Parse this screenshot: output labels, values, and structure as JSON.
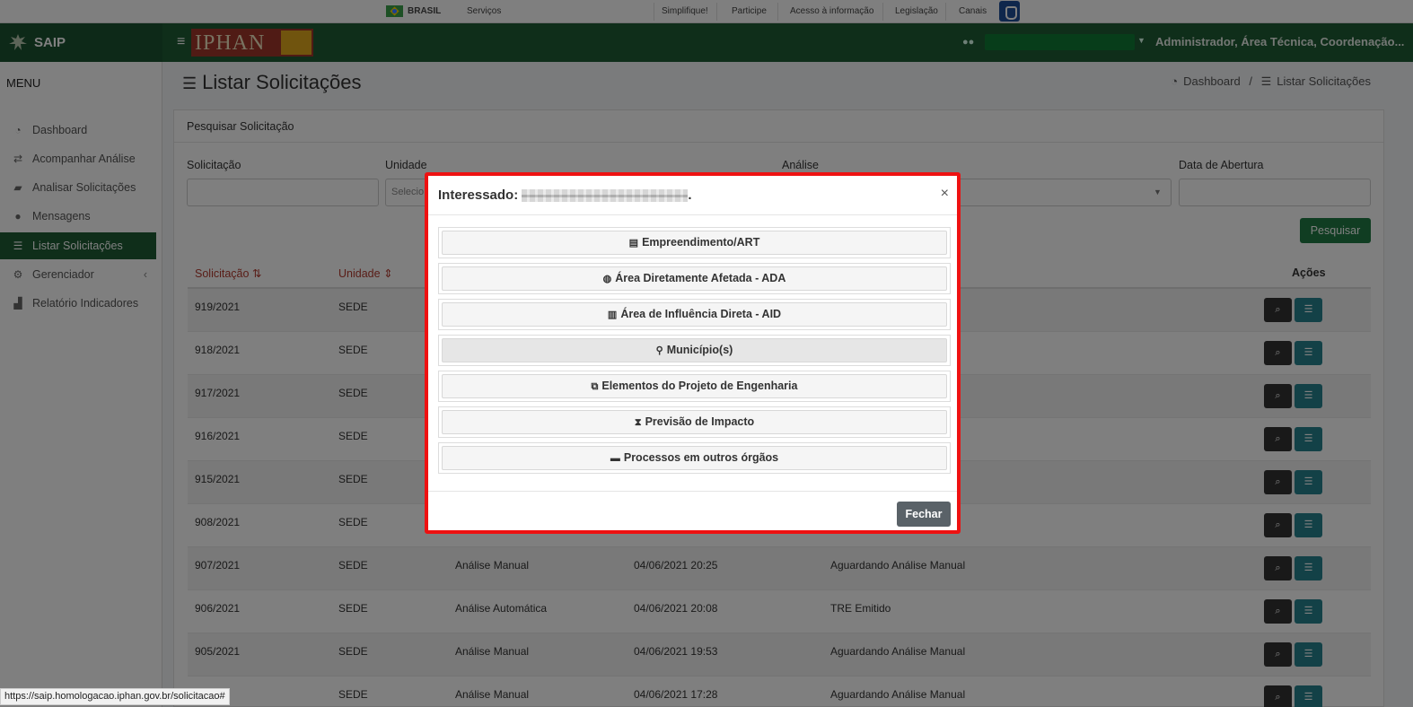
{
  "govbar": {
    "country": "BRASIL",
    "links": [
      "Serviços",
      "Simplifique!",
      "Participe",
      "Acesso à informação",
      "Legislação",
      "Canais"
    ]
  },
  "header": {
    "app_name": "SAIP",
    "logo_text": "IPHAN",
    "roles": "Administrador, Área Técnica, Coordenação..."
  },
  "sidebar": {
    "title": "MENU",
    "items": [
      {
        "label": "Dashboard",
        "icon": "dashboard-icon"
      },
      {
        "label": "Acompanhar Análise",
        "icon": "exchange-icon"
      },
      {
        "label": "Analisar Solicitações",
        "icon": "book-icon"
      },
      {
        "label": "Mensagens",
        "icon": "comments-icon"
      },
      {
        "label": "Listar Solicitações",
        "icon": "list-icon"
      },
      {
        "label": "Gerenciador",
        "icon": "cogs-icon"
      },
      {
        "label": "Relatório Indicadores",
        "icon": "chart-icon"
      }
    ]
  },
  "page": {
    "title": "Listar Solicitações",
    "breadcrumb": [
      "Dashboard",
      "/",
      "Listar Solicitações"
    ]
  },
  "search": {
    "card_title": "Pesquisar Solicitação",
    "labels": {
      "solicitacao": "Solicitação",
      "unidade": "Unidade",
      "analise": "Análise",
      "data": "Data de Abertura"
    },
    "unidade_placeholder": "Selecio",
    "button": "Pesquisar"
  },
  "table": {
    "headers": {
      "solicitacao": "Solicitação",
      "unidade": "Unidade",
      "acoes": "Ações"
    },
    "rows": [
      {
        "id": "919/2021",
        "unidade": "SEDE",
        "analise": "",
        "data": "",
        "status": ""
      },
      {
        "id": "918/2021",
        "unidade": "SEDE",
        "analise": "",
        "data": "",
        "status": ""
      },
      {
        "id": "917/2021",
        "unidade": "SEDE",
        "analise": "",
        "data": "",
        "status": ""
      },
      {
        "id": "916/2021",
        "unidade": "SEDE",
        "analise": "",
        "data": "",
        "status": ""
      },
      {
        "id": "915/2021",
        "unidade": "SEDE",
        "analise": "",
        "data": "",
        "status": ""
      },
      {
        "id": "908/2021",
        "unidade": "SEDE",
        "analise": "",
        "data": "",
        "status": ""
      },
      {
        "id": "907/2021",
        "unidade": "SEDE",
        "analise": "Análise Manual",
        "data": "04/06/2021 20:25",
        "status": "Aguardando Análise Manual"
      },
      {
        "id": "906/2021",
        "unidade": "SEDE",
        "analise": "Análise Automática",
        "data": "04/06/2021 20:08",
        "status": "TRE Emitido"
      },
      {
        "id": "905/2021",
        "unidade": "SEDE",
        "analise": "Análise Manual",
        "data": "04/06/2021 19:53",
        "status": "Aguardando Análise Manual"
      },
      {
        "id": "",
        "unidade": "SEDE",
        "analise": "Análise Manual",
        "data": "04/06/2021 17:28",
        "status": "Aguardando Análise Manual"
      }
    ]
  },
  "modal": {
    "title_prefix": "Interessado:",
    "title_suffix": ".",
    "close_symbol": "×",
    "options": [
      {
        "label": "Empreendimento/ART",
        "icon": "building-icon",
        "glyph": "▤"
      },
      {
        "label": "Área Diretamente Afetada - ADA",
        "icon": "globe-icon",
        "glyph": "◍"
      },
      {
        "label": "Área de Influência Direta - AID",
        "icon": "map-icon",
        "glyph": "▥"
      },
      {
        "label": "Município(s)",
        "icon": "map-marker-icon",
        "glyph": "⚲"
      },
      {
        "label": "Elementos do Projeto de Engenharia",
        "icon": "cubes-icon",
        "glyph": "⧉"
      },
      {
        "label": "Previsão de Impacto",
        "icon": "hourglass-icon",
        "glyph": "⧗"
      },
      {
        "label": "Processos em outros órgãos",
        "icon": "archive-icon",
        "glyph": "▬"
      }
    ],
    "close_button": "Fechar"
  },
  "status_url": "https://saip.homologacao.iphan.gov.br/solicitacao#"
}
